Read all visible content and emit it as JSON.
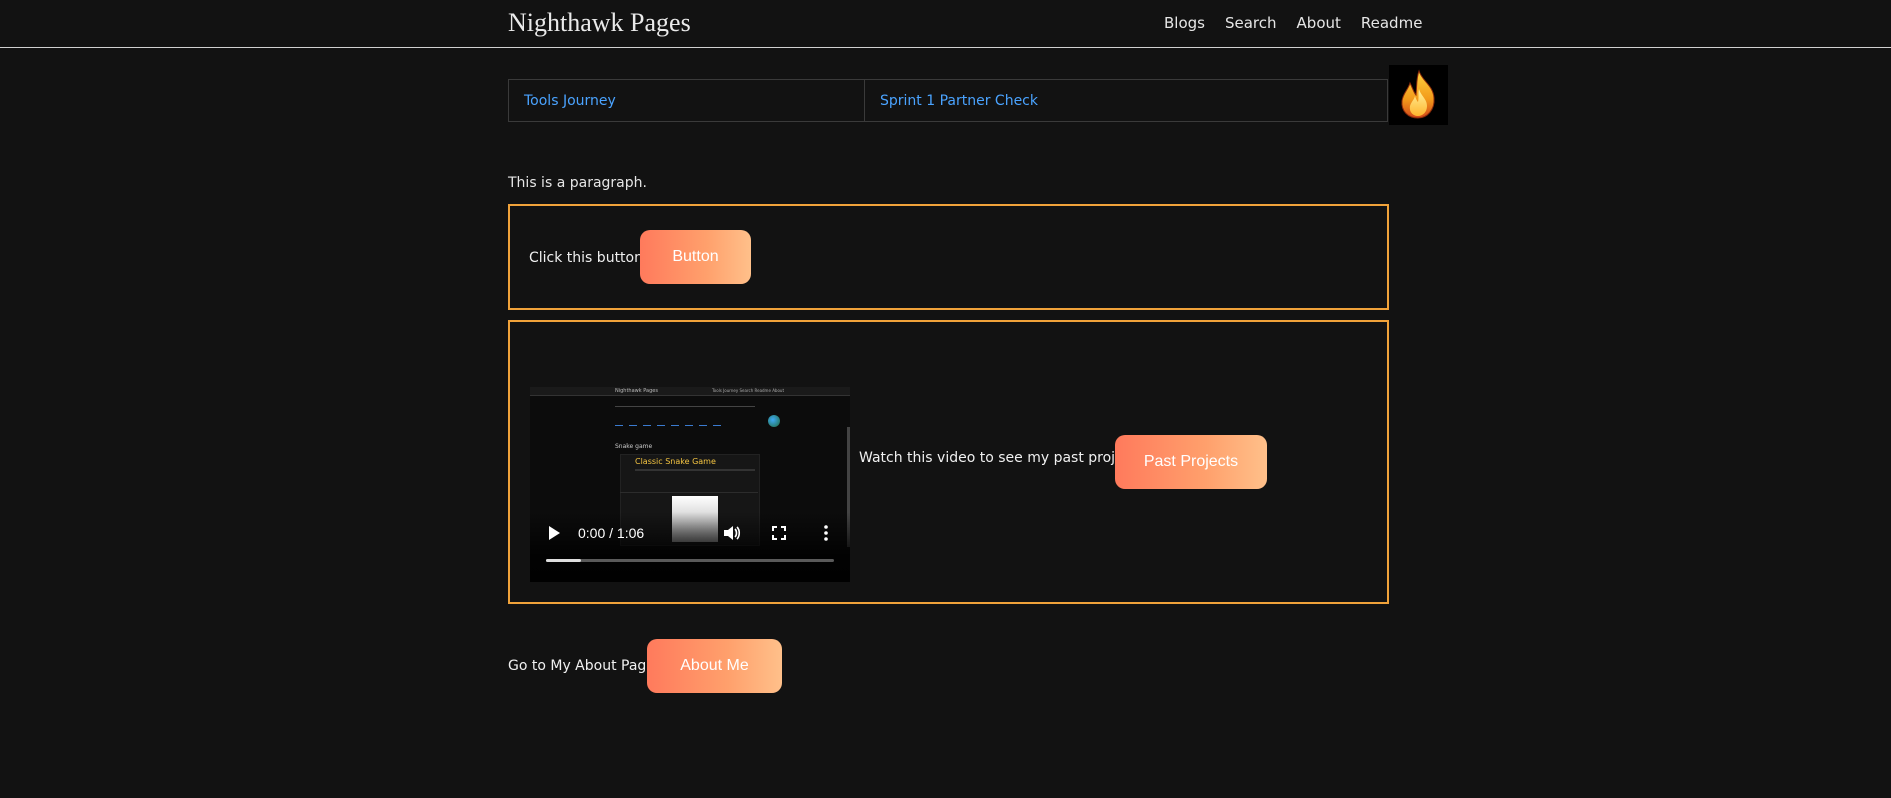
{
  "header": {
    "site_title": "Nighthawk Pages",
    "nav": [
      "Blogs",
      "Search",
      "About",
      "Readme"
    ]
  },
  "links_table": {
    "left": "Tools Journey",
    "right": "Sprint 1 Partner Check"
  },
  "logo": {
    "icon": "flame-icon"
  },
  "paragraph": "This is a paragraph.",
  "button_section": {
    "label": "Click this button!",
    "button_label": "Button"
  },
  "video_section": {
    "label": "Watch this video to see my past projects!",
    "button_label": "Past Projects",
    "video": {
      "time": "0:00 / 1:06",
      "buffered_fraction": 0.12,
      "thumbnail": {
        "title": "Nighthawk Pages",
        "nav": "Tools Journey   Search   Readme   About",
        "section": "Snake game",
        "card_title": "Classic Snake Game"
      }
    }
  },
  "about_section": {
    "label": "Go to My About Page",
    "button_label": "About Me"
  },
  "colors": {
    "background": "#121212",
    "accent_border": "#f0a23a",
    "link": "#4aa3ff",
    "button_gradient_start": "#ff7a5c",
    "button_gradient_end": "#ffc08a"
  }
}
